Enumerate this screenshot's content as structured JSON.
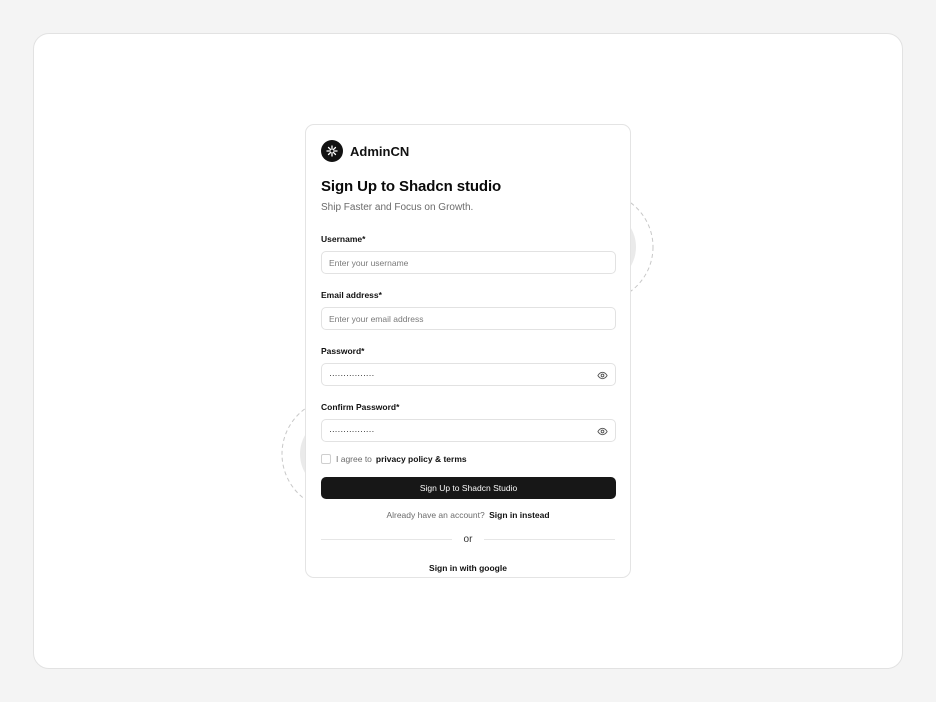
{
  "brand": {
    "name": "AdminCN",
    "logo_icon": "sparkle-icon"
  },
  "heading": {
    "title": "Sign Up to Shadcn studio",
    "subtitle": "Ship Faster and Focus on Growth."
  },
  "form": {
    "username": {
      "label": "Username*",
      "placeholder": "Enter your username",
      "value": ""
    },
    "email": {
      "label": "Email address*",
      "placeholder": "Enter your email address",
      "value": ""
    },
    "password": {
      "label": "Password*",
      "value": "················",
      "toggle_icon": "eye-icon"
    },
    "confirm_password": {
      "label": "Confirm Password*",
      "value": "················",
      "toggle_icon": "eye-icon"
    },
    "agree": {
      "prefix": "I agree to",
      "link": "privacy policy & terms",
      "checked": false
    },
    "submit_label": "Sign Up to Shadcn Studio"
  },
  "signin": {
    "prompt": "Already have an account?",
    "link": "Sign in instead"
  },
  "divider_label": "or",
  "google_label": "Sign in with google",
  "colors": {
    "primary": "#171717",
    "background": "#f4f4f4",
    "card": "#ffffff",
    "border": "#e2e2e2"
  }
}
